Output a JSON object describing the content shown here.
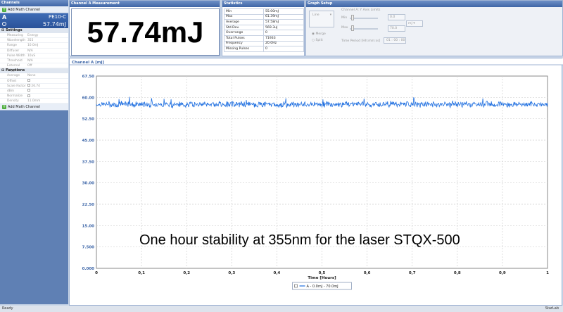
{
  "channels_panel": {
    "title": "Channels",
    "add_math_label": "Add Math Channel",
    "channel": {
      "letter": "A",
      "sensor": "PE10-C",
      "value": "57.74mJ"
    },
    "settings": {
      "heading": "Settings",
      "rows": [
        {
          "k": "Measuring",
          "v": "Energy"
        },
        {
          "k": "Wavelength",
          "v": "355"
        },
        {
          "k": "Range",
          "v": "10.0mJ"
        },
        {
          "k": "Diffuser",
          "v": "N/A"
        },
        {
          "k": "Pulse Width",
          "v": "10uS"
        },
        {
          "k": "Threshold",
          "v": "N/A"
        },
        {
          "k": "External Trigger",
          "v": "Off"
        }
      ]
    },
    "functions": {
      "heading": "Functions",
      "rows": [
        {
          "k": "Average",
          "v": "None"
        },
        {
          "k": "Offset",
          "v": ""
        },
        {
          "k": "Scale Factor",
          "v": "26.74"
        },
        {
          "k": "dBm",
          "v": ""
        },
        {
          "k": "Normalize",
          "v": ""
        },
        {
          "k": "Density",
          "v": "11.0mm"
        }
      ]
    }
  },
  "measurement": {
    "title": "Channel A Measurement",
    "value": "57.74mJ"
  },
  "statistics": {
    "title": "Statistics",
    "rows": [
      {
        "k": "Min",
        "v": "55.00mJ"
      },
      {
        "k": "Max",
        "v": "61.39mJ"
      },
      {
        "k": "Average",
        "v": "57.58mJ"
      },
      {
        "k": "Std.Dev.",
        "v": "569.3uJ"
      },
      {
        "k": "Overrange",
        "v": "0"
      },
      {
        "k": "Total Pulses",
        "v": "71933"
      },
      {
        "k": "Frequency",
        "v": "20.0Hz"
      },
      {
        "k": "Missing Pulses",
        "v": "0"
      }
    ]
  },
  "graph_setup": {
    "title": "Graph Setup",
    "type_value": "Line",
    "merge_label": "Merge",
    "split_label": "Split",
    "axis_limits_label": "Channel A: Y Axis Limits",
    "min_label": "Min",
    "max_label": "Max",
    "min_value": "0.0",
    "max_value": "70.0",
    "unit_value": "mJ",
    "time_label": "Time Period [Hh:mm:ss]",
    "time_value": "01 : 00 : 00"
  },
  "chart_data": {
    "type": "line",
    "title": "Channel A [mJ]",
    "xlabel": "Time [Hours]",
    "ylabel": "",
    "xlim": [
      0,
      1
    ],
    "ylim": [
      0,
      67.5
    ],
    "xticks": [
      "0",
      "0,1",
      "0,2",
      "0,3",
      "0,4",
      "0,5",
      "0,6",
      "0,7",
      "0,8",
      "0,9",
      "1"
    ],
    "yticks": [
      "67.50",
      "60.00",
      "52.50",
      "45.00",
      "37.50",
      "30.00",
      "22.50",
      "15.00",
      "7.500",
      "0.000"
    ],
    "grid": true,
    "series": [
      {
        "name": "A - 0.0mJ - 70.0mJ",
        "color": "#1f6fe0",
        "mean": 57.58,
        "min": 55.0,
        "max": 61.39
      }
    ],
    "legend_position": "bottom-center"
  },
  "overlay_text": "One hour stability at 355nm for the laser STQX-500",
  "statusbar": {
    "left": "Ready",
    "right": "StarLab"
  }
}
